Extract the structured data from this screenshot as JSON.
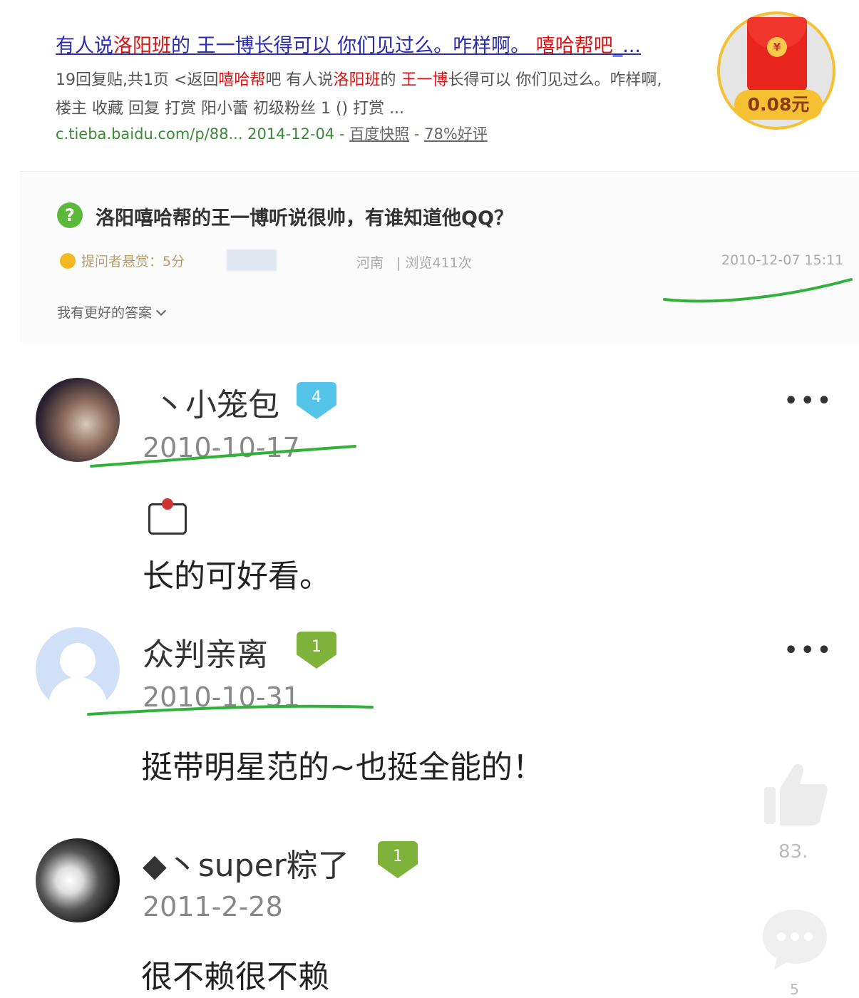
{
  "snippet": {
    "title_a": "有人说",
    "title_b": "洛阳班",
    "title_c": "的 王一博长得可以 你们见过么。咋样啊。 ",
    "title_d": "嘻哈帮吧",
    "title_e": "_...",
    "line1_a": "19回复贴,共1页 <返回",
    "line1_b": "嘻哈帮",
    "line1_c": "吧 有人说",
    "line1_d": "洛阳班",
    "line1_e": "的 ",
    "line1_f": "王一博",
    "line1_g": "长得可以 你们见过么。咋样啊,",
    "line2": "楼主 收藏 回复 打赏 阳小蕾 初级粉丝 1 () 打赏 ...",
    "url": "c.tieba.baidu.com/p/88... 2014-12-04",
    "url_sep": " - ",
    "cache": "百度快照",
    "rating": "78%好评"
  },
  "question": {
    "icon": "?",
    "title": "洛阳嘻哈帮的王一博听说很帅，有谁知道他QQ？",
    "reward": "提问者悬赏：5分",
    "location": "河南",
    "views": "|   浏览411次",
    "date": "2010-12-07 15:11",
    "better_answer": "我有更好的答案"
  },
  "red_envelope": {
    "coin_symbol": "¥",
    "amount": "0.08元"
  },
  "comments": [
    {
      "username": "丶小笼包",
      "level": "4",
      "date": "2010-10-17",
      "text": "长的可好看。",
      "more": "•••"
    },
    {
      "username": "众判亲离",
      "level": "1",
      "date": "2010-10-31",
      "text": "挺带明星范的~也挺全能的！",
      "more": "•••"
    },
    {
      "username": "◆丶super粽了",
      "level": "1",
      "date": "2011-2-28",
      "text": "很不赖很不赖"
    }
  ],
  "side_actions": {
    "like_count": "83.",
    "comment_count": "5"
  },
  "colors": {
    "highlight_red": "#dd1111",
    "annotation_green": "#2fb13a",
    "badge_blue": "#54c5e8",
    "badge_green": "#7fb23a",
    "envelope_red": "#e8241e",
    "envelope_gold": "#f5c032"
  }
}
